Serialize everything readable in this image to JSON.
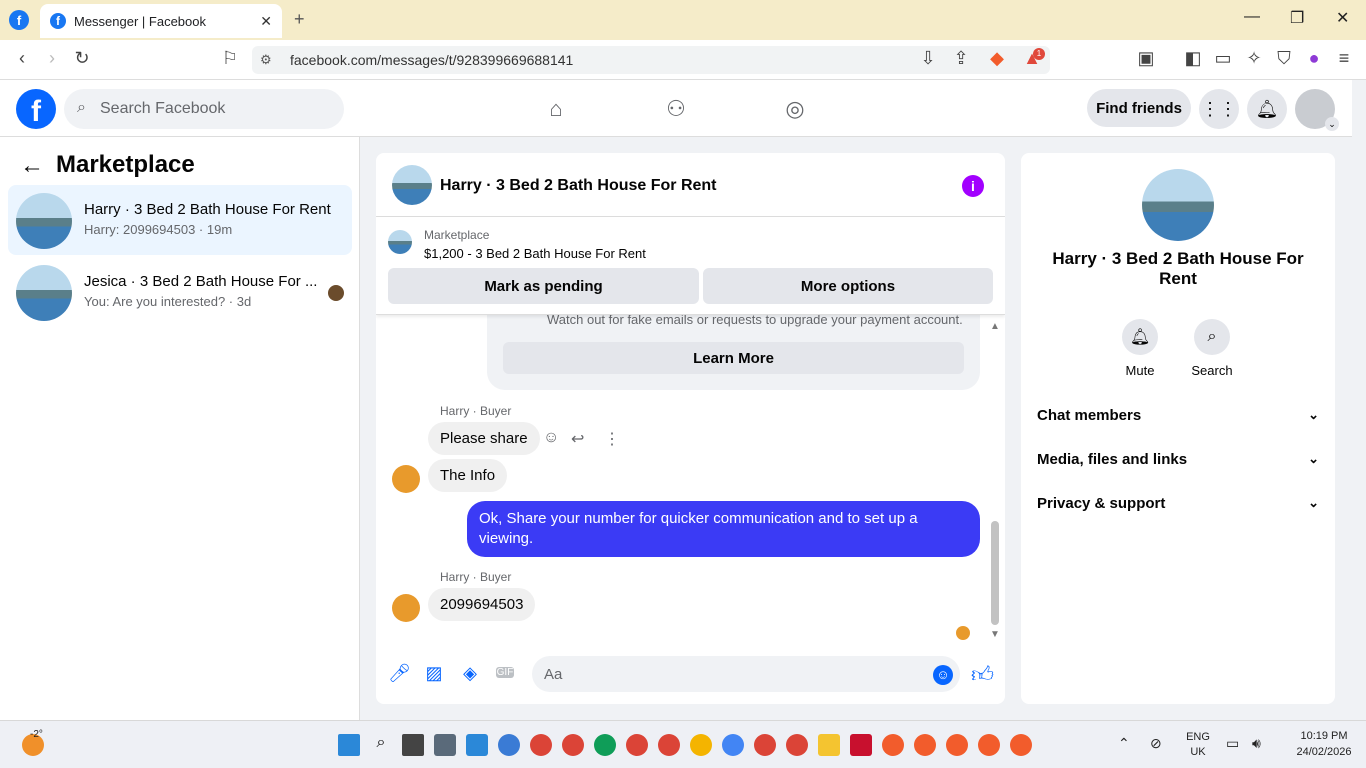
{
  "browser": {
    "tab_title": "Messenger | Facebook",
    "url": "facebook.com/messages/t/928399669688141",
    "notif_count": "1"
  },
  "fb": {
    "search_placeholder": "Search Facebook",
    "find_friends": "Find friends"
  },
  "left": {
    "title": "Marketplace",
    "conversations": [
      {
        "name": "Harry · 3 Bed 2 Bath House For Rent",
        "snippet": "Harry: 2099694503 · 19m"
      },
      {
        "name": "Jesica · 3 Bed 2 Bath House For ...",
        "snippet": "You: Are you interested? · 3d"
      }
    ]
  },
  "chat": {
    "title": "Harry · 3 Bed 2 Bath House For Rent",
    "marketplace_label": "Marketplace",
    "listing": "$1,200 - 3 Bed 2 Bath House For Rent",
    "mark_pending": "Mark as pending",
    "more_options": "More options",
    "warning_text": "Watch out for fake emails or requests to upgrade your payment account.",
    "learn_more": "Learn More",
    "sender1": "Harry · Buyer",
    "msg1": "Please share",
    "msg2": "The Info",
    "msg3": "Ok, Share your number for quicker communication and to set up a viewing.",
    "sender2": "Harry · Buyer",
    "msg4": "2099694503",
    "composer_placeholder": "Aa",
    "gif_label": "GIF"
  },
  "right": {
    "name": "Harry · 3 Bed 2 Bath House For Rent",
    "mute": "Mute",
    "search": "Search",
    "sections": [
      "Chat members",
      "Media, files and links",
      "Privacy & support"
    ]
  },
  "taskbar": {
    "temp": "-2°",
    "lang1": "ENG",
    "lang2": "UK",
    "time": "10:19 PM",
    "date": "24/02/2026"
  },
  "colors": {
    "fb_blue": "#0866ff",
    "my_bubble": "#3b3bf5",
    "info_purple": "#a200ff"
  }
}
